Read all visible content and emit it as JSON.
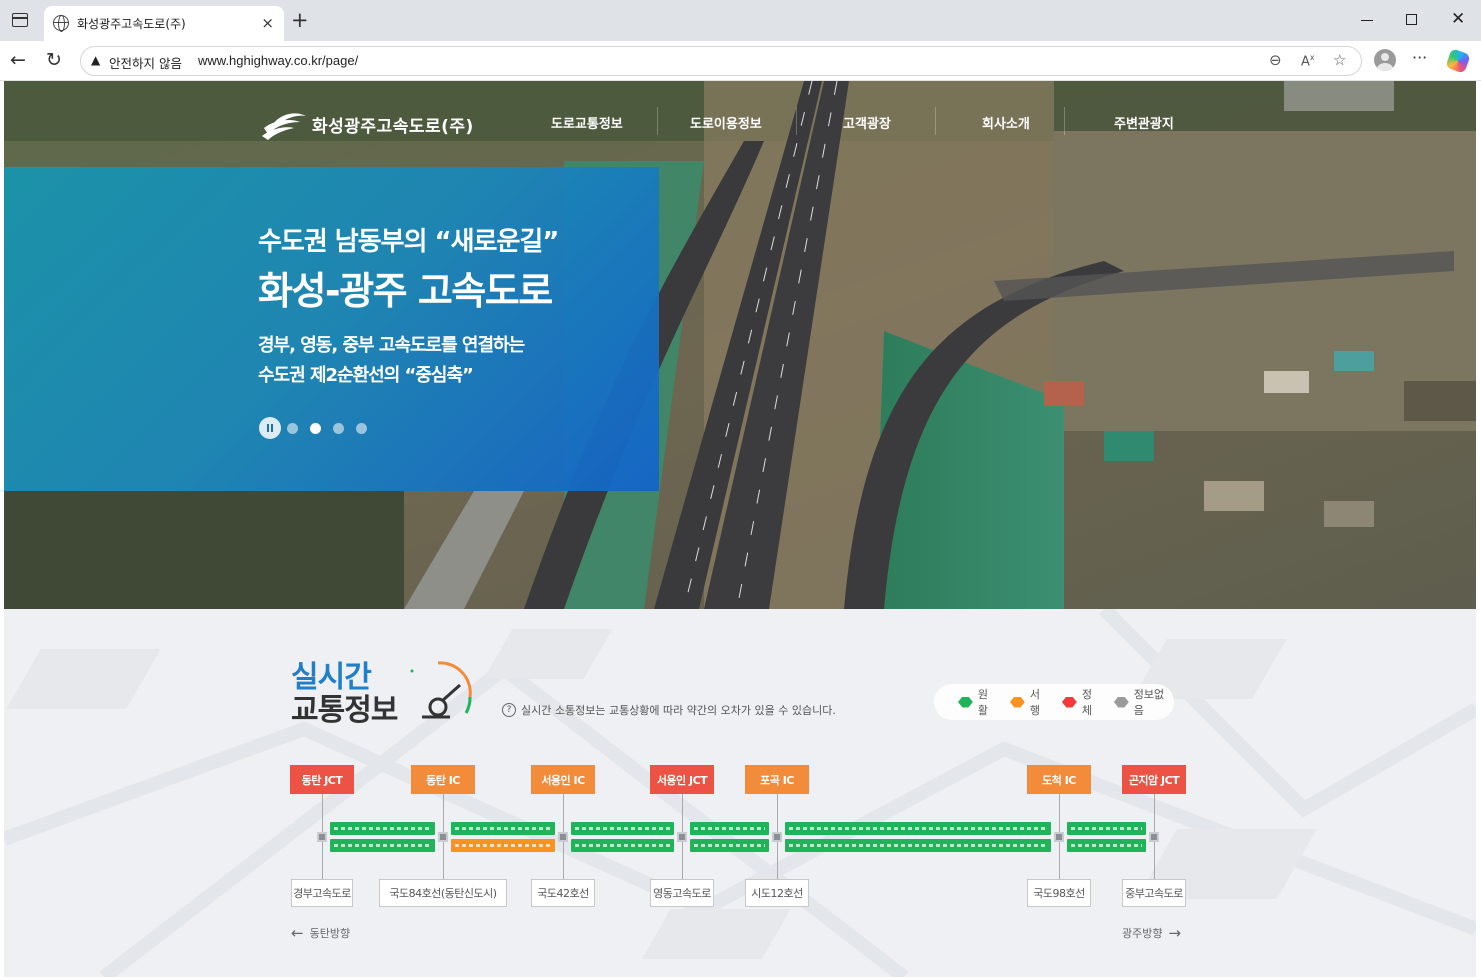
{
  "browser": {
    "tab_title": "화성광주고속도로(주)",
    "tab_close": "×",
    "new_tab": "+",
    "security_label": "안전하지 않음",
    "url": "www.hghighway.co.kr/page/",
    "more": "···"
  },
  "site": {
    "logo_text": "화성광주고속도로(주)",
    "nav": [
      "도로교통정보",
      "도로이용정보",
      "고객광장",
      "회사소개",
      "주변관광지"
    ]
  },
  "hero": {
    "subtitle": "수도권 남동부의 “새로운길”",
    "title": "화성-광주 고속도로",
    "desc_line1": "경부, 영동, 중부 고속도로를 연결하는",
    "desc_line2": "수도권 제2순환선의 “중심축”",
    "slides_total": 4,
    "active_slide": 2
  },
  "traffic": {
    "title_line1": "실시간",
    "title_line2": "교통정보",
    "notice_icon": "?",
    "notice": "실시간 소통정보는 교통상황에 따라 약간의 오차가 있을 수 있습니다.",
    "legend": [
      {
        "label": "원활",
        "color": "#1fb35a"
      },
      {
        "label": "서행",
        "color": "#f7931e"
      },
      {
        "label": "정체",
        "color": "#ef3b3b"
      },
      {
        "label": "정보없음",
        "color": "#9a9a9a"
      }
    ],
    "interchanges": [
      {
        "name": "동탄 JCT",
        "type": "JCT",
        "color": "#ec5344",
        "road": "경부고속도로"
      },
      {
        "name": "동탄 IC",
        "type": "IC",
        "color": "#f28b3a",
        "road": "국도84호선(동탄신도시)"
      },
      {
        "name": "서용인 IC",
        "type": "IC",
        "color": "#f28b3a",
        "road": "국도42호선"
      },
      {
        "name": "서용인 JCT",
        "type": "JCT",
        "color": "#ec5344",
        "road": "영동고속도로"
      },
      {
        "name": "포곡 IC",
        "type": "IC",
        "color": "#f28b3a",
        "road": "시도12호선"
      },
      {
        "name": "도척 IC",
        "type": "IC",
        "color": "#f28b3a",
        "road": "국도98호선"
      },
      {
        "name": "곤지암 JCT",
        "type": "JCT",
        "color": "#ec5344",
        "road": "중부고속도로"
      }
    ],
    "segments": [
      {
        "up": "#1fb35a",
        "down": "#1fb35a"
      },
      {
        "up": "#1fb35a",
        "down": "#f7931e"
      },
      {
        "up": "#1fb35a",
        "down": "#1fb35a"
      },
      {
        "up": "#1fb35a",
        "down": "#1fb35a"
      },
      {
        "up": "#1fb35a",
        "down": "#1fb35a"
      },
      {
        "up": "#1fb35a",
        "down": "#1fb35a"
      }
    ],
    "direction_left": "동탄방향",
    "direction_right": "광주방향",
    "arrow_left": "←",
    "arrow_right": "→"
  }
}
